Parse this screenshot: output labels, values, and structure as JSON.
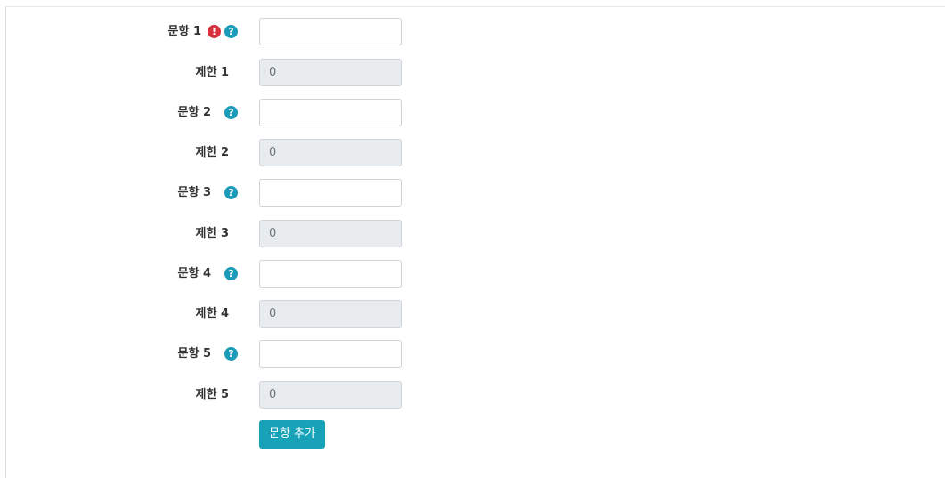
{
  "form": {
    "rows": [
      {
        "question_label": "문항 1",
        "question_value": "",
        "limit_label": "제한 1",
        "limit_value": "0",
        "has_alert": true
      },
      {
        "question_label": "문항 2",
        "question_value": "",
        "limit_label": "제한 2",
        "limit_value": "0",
        "has_alert": false
      },
      {
        "question_label": "문항 3",
        "question_value": "",
        "limit_label": "제한 3",
        "limit_value": "0",
        "has_alert": false
      },
      {
        "question_label": "문항 4",
        "question_value": "",
        "limit_label": "제한 4",
        "limit_value": "0",
        "has_alert": false
      },
      {
        "question_label": "문항 5",
        "question_value": "",
        "limit_label": "제한 5",
        "limit_value": "0",
        "has_alert": false
      }
    ],
    "add_button_label": "문항 추가",
    "alert_icon_glyph": "!",
    "help_icon_glyph": "?",
    "colors": {
      "alert": "#d9303e",
      "help": "#1c9bb9",
      "button": "#17a2b8",
      "readonly_bg": "#e9ecef"
    }
  }
}
